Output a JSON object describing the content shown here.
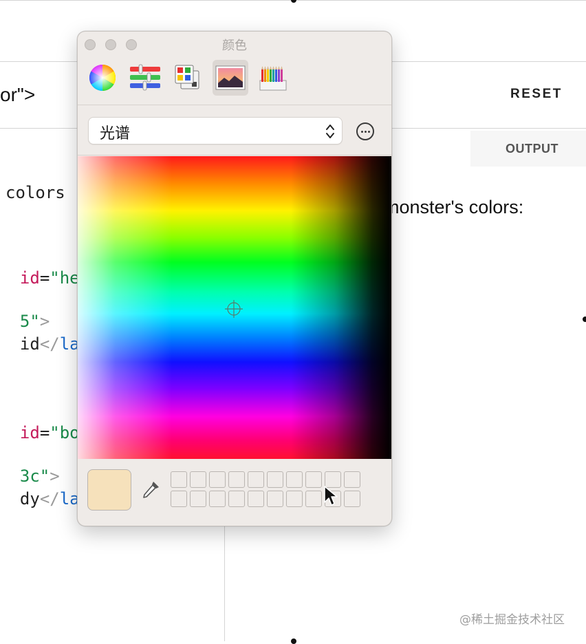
{
  "editor": {
    "code_line_1": "or\">",
    "reset_label": "RESET",
    "output_tab_label": "OUTPUT",
    "code_comment_fragment": "colors",
    "code_lines": [
      {
        "attr": "id",
        "eq": "=",
        "str": "\"head"
      },
      {
        "str": "5\"",
        "gray": ">"
      },
      {
        "plain": "id",
        "gray": "</",
        "tag": "labe"
      },
      {
        "attr": "id",
        "eq": "=",
        "str": "\"body"
      },
      {
        "str": "3c\"",
        "gray": ">"
      },
      {
        "plain": "dy",
        "gray": "</",
        "tag": "labe"
      }
    ],
    "output_text": "monster's colors:"
  },
  "color_panel": {
    "title": "颜色",
    "modes": [
      {
        "name": "color-wheel",
        "icon": "color-wheel-icon"
      },
      {
        "name": "color-sliders",
        "icon": "sliders-icon"
      },
      {
        "name": "color-palettes",
        "icon": "palette-icon"
      },
      {
        "name": "image-palettes",
        "icon": "image-palette-icon",
        "active": true
      },
      {
        "name": "pencils",
        "icon": "pencils-icon"
      }
    ],
    "palette_select_value": "光谱",
    "current_color": "#f6e1bb",
    "accent": "#0a84ff"
  },
  "watermark": "@稀土掘金技术社区"
}
